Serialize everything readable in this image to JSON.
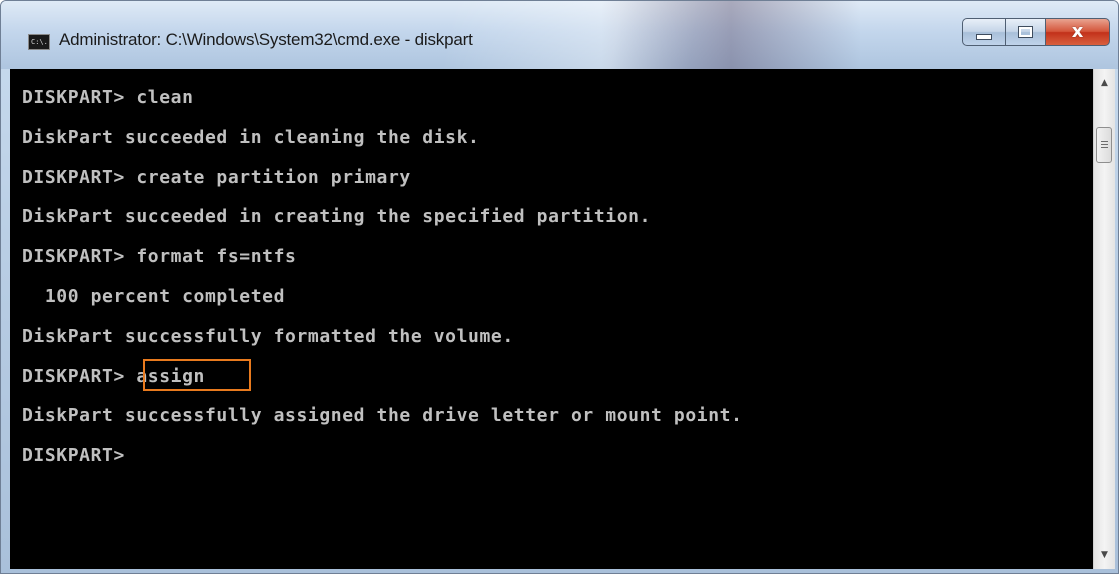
{
  "window": {
    "title": "Administrator: C:\\Windows\\System32\\cmd.exe - diskpart",
    "app_icon_text": "C:\\.",
    "caption_buttons": {
      "minimize_icon": "minimize-icon",
      "maximize_icon": "maximize-icon",
      "close_label": "x"
    }
  },
  "console": {
    "lines": [
      "DISKPART> clean",
      "DiskPart succeeded in cleaning the disk.",
      "DISKPART> create partition primary",
      "DiskPart succeeded in creating the specified partition.",
      "DISKPART> format fs=ntfs",
      "  100 percent completed",
      "DiskPart successfully formatted the volume.",
      "DISKPART> assign",
      "DiskPart successfully assigned the drive letter or mount point.",
      "DISKPART>"
    ],
    "highlighted_command": "assign",
    "highlight_color": "#e87a1e",
    "text_color": "#c0c0c0",
    "background_color": "#000000"
  },
  "scrollbar": {
    "up_icon": "scroll-up-arrow-icon",
    "down_icon": "scroll-down-arrow-icon"
  }
}
